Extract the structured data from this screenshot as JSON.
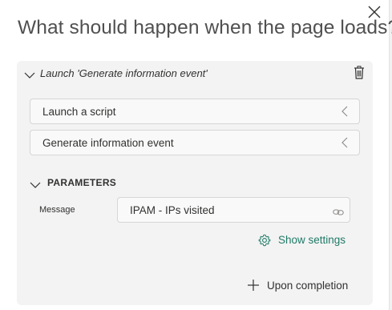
{
  "dialog": {
    "title": "What should happen when the page loads?",
    "close_icon": "close-icon"
  },
  "card": {
    "title": "Launch 'Generate information event'",
    "delete_icon": "trash-icon"
  },
  "actions": [
    {
      "label": "Launch a script"
    },
    {
      "label": "Generate information event"
    }
  ],
  "parameters": {
    "header": "PARAMETERS",
    "message_label": "Message",
    "message_value": "IPAM - IPs visited"
  },
  "show_settings_label": "Show settings",
  "upon_completion_label": "Upon completion",
  "colors": {
    "accent": "#1f7a67",
    "card_bg": "#f3f3f3",
    "field_bg": "#f9f9f9",
    "field_border": "#d6d6d6",
    "title_text": "#505050"
  }
}
